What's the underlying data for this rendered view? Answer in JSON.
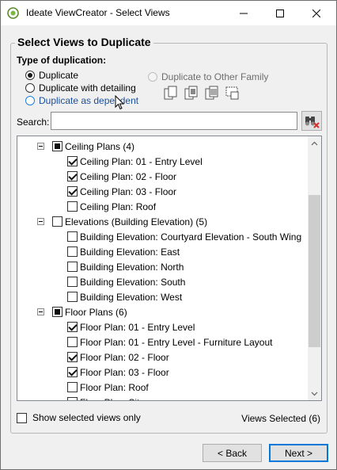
{
  "window": {
    "title": "Ideate ViewCreator - Select Views",
    "icons": {
      "app": "ideate-app-icon",
      "minimize": "minimize-icon",
      "maximize": "maximize-icon",
      "close": "close-icon"
    }
  },
  "group_title": "Select Views to Duplicate",
  "duplication": {
    "label": "Type of duplication:",
    "options": [
      {
        "label": "Duplicate",
        "checked": true
      },
      {
        "label": "Duplicate with detailing",
        "checked": false
      },
      {
        "label": "Duplicate as dependent",
        "checked": false
      },
      {
        "label": "Duplicate to Other Family",
        "checked": false,
        "disabled": true
      }
    ],
    "tool_icons": [
      "duplicate-view-icon",
      "duplicate-detailing-icon",
      "duplicate-table-icon",
      "duplicate-dependent-icon"
    ]
  },
  "search": {
    "label": "Search:",
    "value": "",
    "placeholder": "",
    "button_icon": "binoculars-clear-icon"
  },
  "tree": {
    "groups": [
      {
        "label": "Ceiling Plans (4)",
        "state": "indeterminate",
        "items": [
          {
            "label": "Ceiling Plan: 01 - Entry Level",
            "checked": true
          },
          {
            "label": "Ceiling Plan: 02 - Floor",
            "checked": true
          },
          {
            "label": "Ceiling Plan: 03 - Floor",
            "checked": true
          },
          {
            "label": "Ceiling Plan: Roof",
            "checked": false
          }
        ]
      },
      {
        "label": "Elevations (Building Elevation) (5)",
        "state": "unchecked",
        "items": [
          {
            "label": "Building Elevation: Courtyard Elevation - South Wing",
            "checked": false
          },
          {
            "label": "Building Elevation: East",
            "checked": false
          },
          {
            "label": "Building Elevation: North",
            "checked": false
          },
          {
            "label": "Building Elevation: South",
            "checked": false
          },
          {
            "label": "Building Elevation: West",
            "checked": false
          }
        ]
      },
      {
        "label": "Floor Plans (6)",
        "state": "indeterminate",
        "items": [
          {
            "label": "Floor Plan: 01 - Entry Level",
            "checked": true
          },
          {
            "label": "Floor Plan: 01 - Entry Level - Furniture Layout",
            "checked": false
          },
          {
            "label": "Floor Plan: 02 - Floor",
            "checked": true
          },
          {
            "label": "Floor Plan: 03 - Floor",
            "checked": true
          },
          {
            "label": "Floor Plan: Roof",
            "checked": false
          },
          {
            "label": "Floor Plan: Site",
            "checked": false
          }
        ]
      }
    ]
  },
  "footer": {
    "show_selected_label": "Show selected views only",
    "show_selected_checked": false,
    "views_selected": "Views Selected (6)"
  },
  "buttons": {
    "back": "< Back",
    "next": "Next >"
  },
  "colors": {
    "accent": "#0078d7",
    "window_bg": "#f0f0f0"
  }
}
